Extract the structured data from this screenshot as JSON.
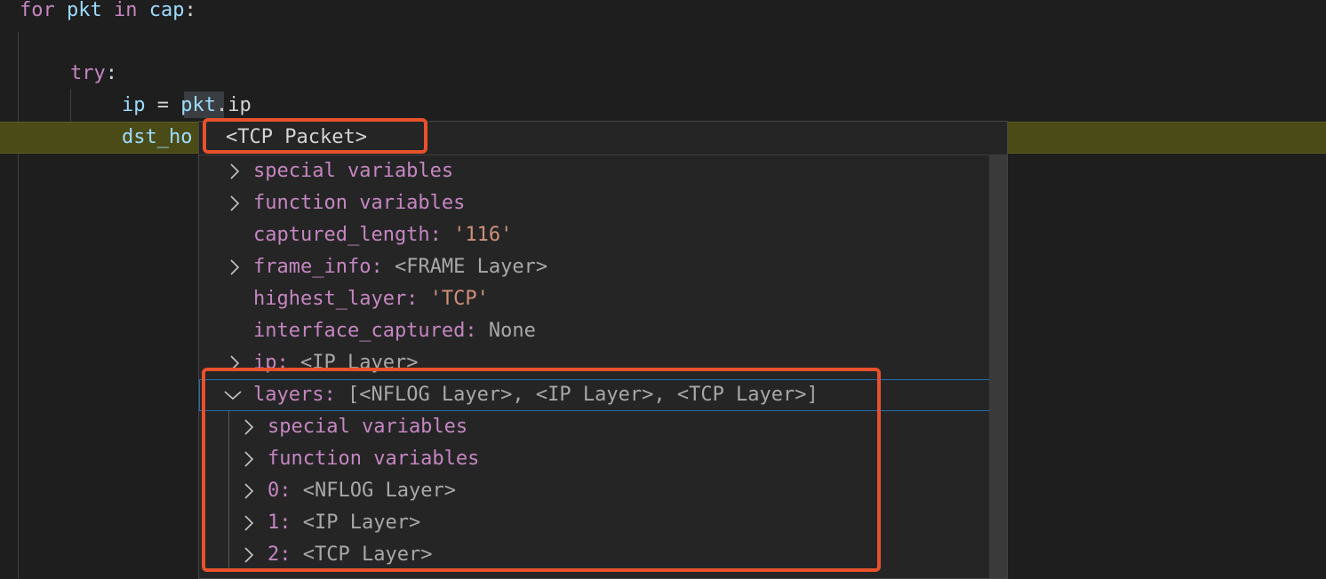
{
  "code": {
    "line1": {
      "kw": "for",
      "var1": "pkt",
      "in": "in",
      "var2": "cap",
      "colon": ":"
    },
    "line2": {
      "kw": "try",
      "colon": ":"
    },
    "line3": {
      "lhs": "ip",
      "op": " = ",
      "obj": "pkt",
      "dot": ".",
      "attr": "ip"
    },
    "line4": {
      "lhs": "dst_ho"
    }
  },
  "hover": {
    "header": "<TCP Packet>",
    "rows": [
      {
        "name": "special variables",
        "value": "",
        "expandable": true,
        "expanded": false
      },
      {
        "name": "function variables",
        "value": "",
        "expandable": true,
        "expanded": false
      },
      {
        "name": "captured_length:",
        "value": "'116'",
        "expandable": false
      },
      {
        "name": "frame_info:",
        "value": "<FRAME Layer>",
        "expandable": true,
        "expanded": false
      },
      {
        "name": "highest_layer:",
        "value": "'TCP'",
        "expandable": false
      },
      {
        "name": "interface_captured:",
        "value": "None",
        "expandable": false
      },
      {
        "name": "ip:",
        "value": "<IP Layer>",
        "expandable": true,
        "expanded": false
      },
      {
        "name": "layers:",
        "value": "[<NFLOG Layer>, <IP Layer>, <TCP Layer>]",
        "expandable": true,
        "expanded": true,
        "selected": true
      }
    ],
    "children": [
      {
        "name": "special variables",
        "value": ""
      },
      {
        "name": "function variables",
        "value": ""
      },
      {
        "name": "0:",
        "value": "<NFLOG Layer>"
      },
      {
        "name": "1:",
        "value": "<IP Layer>"
      },
      {
        "name": "2:",
        "value": "<TCP Layer>"
      }
    ]
  },
  "colors": {
    "annotation": "#e8512c",
    "debug_line": "#4b4b18",
    "selection_outline": "#1f6fb0"
  }
}
